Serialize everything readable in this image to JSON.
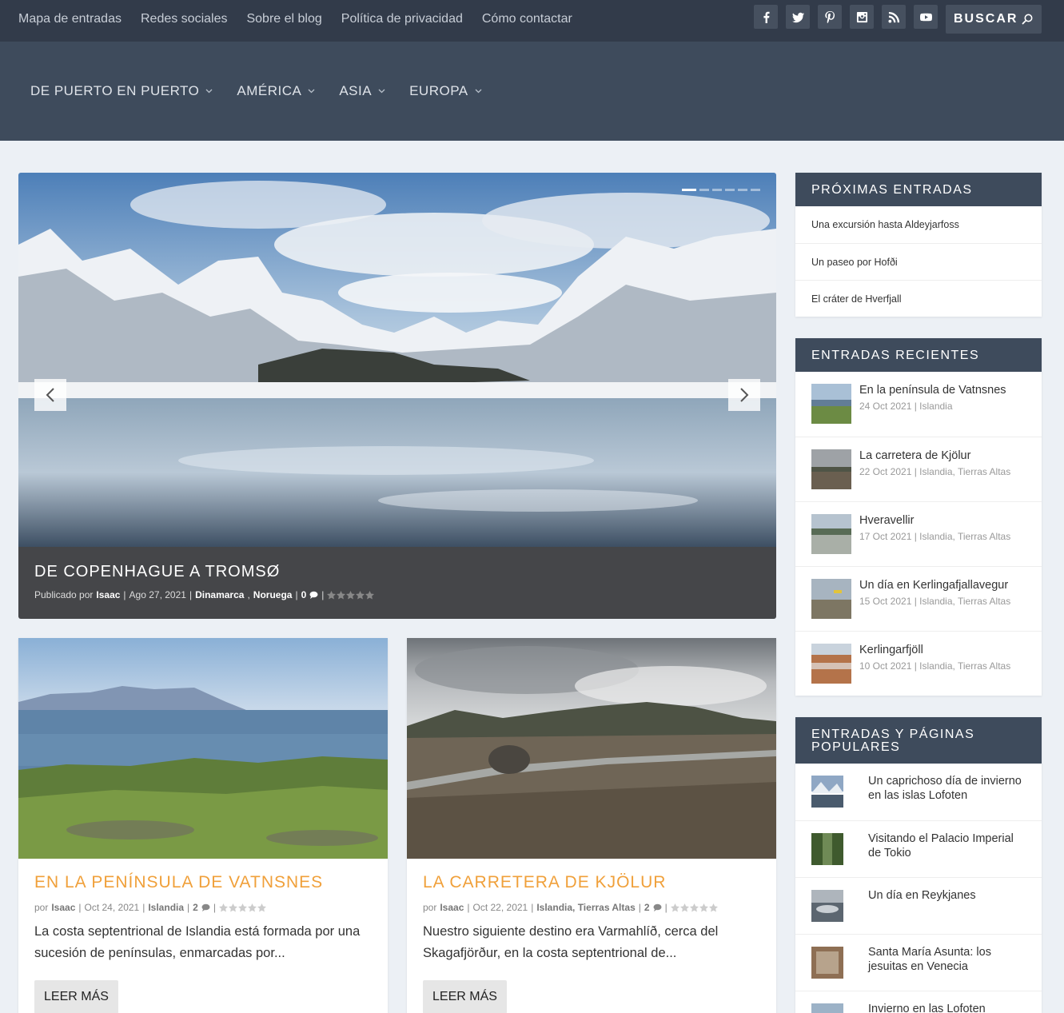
{
  "top_links": [
    "Mapa de entradas",
    "Redes sociales",
    "Sobre el blog",
    "Política de privacidad",
    "Cómo contactar"
  ],
  "social_icons": [
    "facebook-icon",
    "twitter-icon",
    "pinterest-icon",
    "instagram-icon",
    "rss-icon",
    "youtube-icon"
  ],
  "search": {
    "placeholder": "BUSCAR"
  },
  "nav": [
    "DE PUERTO EN PUERTO",
    "AMÉRICA",
    "ASIA",
    "EUROPA"
  ],
  "slider": {
    "title": "DE COPENHAGUE A TROMSØ",
    "meta_prefix": "Publicado por",
    "author": "Isaac",
    "date": "Ago 27, 2021",
    "categories": [
      "Dinamarca",
      "Noruega"
    ],
    "comments": "0",
    "slide_count": 6,
    "active_slide": 1
  },
  "posts": [
    {
      "title": "EN LA PENÍNSULA DE VATNSNES",
      "by": "por",
      "author": "Isaac",
      "date": "Oct 24, 2021",
      "categories": "Islandia",
      "comments": "2",
      "excerpt": "La costa septentrional de Islandia está formada por una sucesión de penínsulas, enmarcadas por...",
      "button": "LEER MÁS"
    },
    {
      "title": "LA CARRETERA DE KJÖLUR",
      "by": "por",
      "author": "Isaac",
      "date": "Oct 22, 2021",
      "categories": "Islandia, Tierras Altas",
      "comments": "2",
      "excerpt": "Nuestro siguiente destino era Varmahlíð, cerca del Skagafjörður, en la costa septentrional de...",
      "button": "LEER MÁS"
    }
  ],
  "upcoming": {
    "title": "PRÓXIMAS ENTRADAS",
    "items": [
      "Una excursión hasta Aldeyjarfoss",
      "Un paseo por Hofði",
      "El cráter de Hverfjall"
    ]
  },
  "recent": {
    "title": "ENTRADAS RECIENTES",
    "items": [
      {
        "title": "En la península de Vatnsnes",
        "meta": "24 Oct 2021 | Islandia"
      },
      {
        "title": "La carretera de Kjölur",
        "meta": "22 Oct 2021 | Islandia, Tierras Altas"
      },
      {
        "title": "Hveravellir",
        "meta": "17 Oct 2021 | Islandia, Tierras Altas"
      },
      {
        "title": "Un día en Kerlingafjallavegur",
        "meta": "15 Oct 2021 | Islandia, Tierras Altas"
      },
      {
        "title": "Kerlingarfjöll",
        "meta": "10 Oct 2021 | Islandia, Tierras Altas"
      }
    ]
  },
  "popular": {
    "title": "ENTRADAS Y PÁGINAS POPULARES",
    "items": [
      "Un caprichoso día de invierno en las islas Lofoten",
      "Visitando el Palacio Imperial de Tokio",
      "Un día en Reykjanes",
      "Santa María Asunta: los jesuitas en Venecia",
      "Invierno en las Lofoten"
    ]
  },
  "colors": {
    "topbar": "#323b4a",
    "nav": "#3e4b5c",
    "accent": "#f0a03a",
    "page_bg": "#ecf0f5"
  }
}
